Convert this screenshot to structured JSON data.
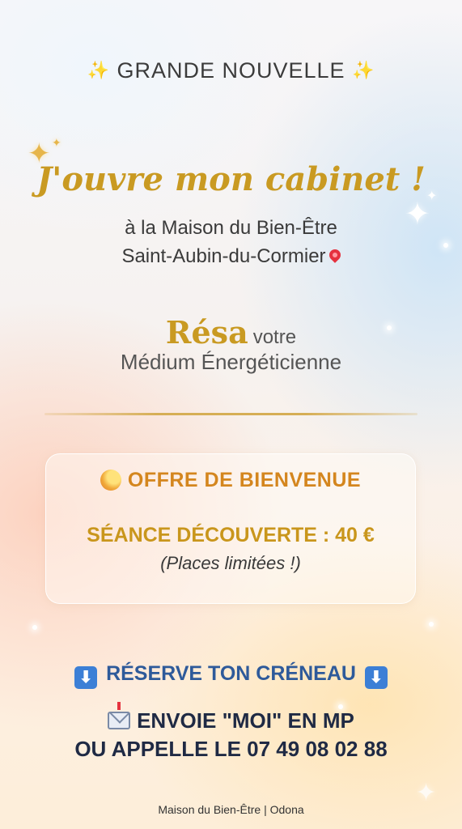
{
  "header": {
    "title": "GRANDE NOUVELLE"
  },
  "headline": "J'ouvre mon cabinet !",
  "location": {
    "line1": "à la Maison du Bien-Être",
    "line2": "Saint-Aubin-du-Cormier"
  },
  "practitioner": {
    "name": "Résa",
    "name_suffix": "votre",
    "role": "Médium Énergéticienne"
  },
  "offer": {
    "title": "OFFRE DE BIENVENUE",
    "price_line": "SÉANCE DÉCOUVERTE : 40 €",
    "note": "(Places limitées !)"
  },
  "cta": {
    "reserve": "RÉSERVE TON CRÉNEAU",
    "line1": "ENVOIE \"MOI\" EN MP",
    "line2": "OU APPELLE LE 07 49 08 02 88"
  },
  "footer": "Maison du Bien-Être | Odona",
  "icons": [
    "sparkles-icon",
    "pin-icon",
    "comet-icon",
    "down-arrow-icon",
    "envelope-icon"
  ],
  "colors": {
    "gold": "#c99a22",
    "orange": "#d4861e",
    "blue": "#2e5a9a",
    "navy": "#1f2a44"
  }
}
